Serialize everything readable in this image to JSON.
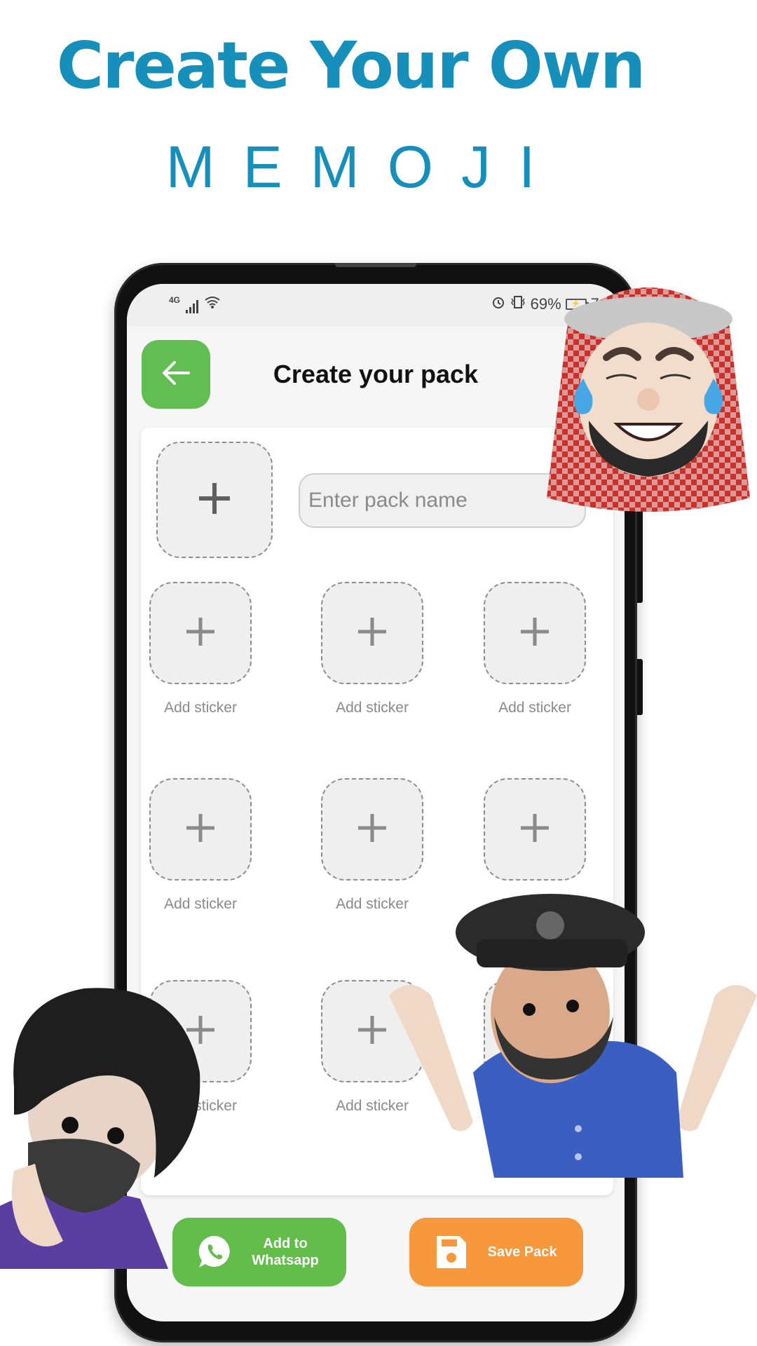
{
  "promo": {
    "headline": "Create Your Own",
    "subheadline": "MEMOJI"
  },
  "status_bar": {
    "network": "4G",
    "battery_percent": "69%",
    "time_partial": "7:"
  },
  "app_bar": {
    "title": "Create your pack",
    "back_icon": "arrow-left-icon"
  },
  "pack": {
    "tray_icon_slot_icon": "plus-icon",
    "name_input": {
      "value": "",
      "placeholder": "Enter pack name"
    }
  },
  "stickers": [
    {
      "label": "Add sticker"
    },
    {
      "label": "Add sticker"
    },
    {
      "label": "Add sticker"
    },
    {
      "label": "Add sticker"
    },
    {
      "label": "Add sticker"
    },
    {
      "label": "Add sticker"
    },
    {
      "label": "Add sticker"
    },
    {
      "label": "Add sticker"
    },
    {
      "label": "Add sticker"
    }
  ],
  "actions": {
    "add_to_whatsapp": "Add to Whatsapp",
    "add_to_whatsapp_line1": "Add to",
    "add_to_whatsapp_line2": "Whatsapp",
    "save_pack": "Save Pack"
  },
  "colors": {
    "brand_text": "#168fba",
    "back_button": "#62bd53",
    "whatsapp_button": "#62bd4b",
    "save_button": "#f7983d"
  },
  "decorations": [
    {
      "name": "memoji-keffiyeh-laughing"
    },
    {
      "name": "memoji-masked-curly-hair"
    },
    {
      "name": "memoji-cap-shrugging"
    }
  ]
}
